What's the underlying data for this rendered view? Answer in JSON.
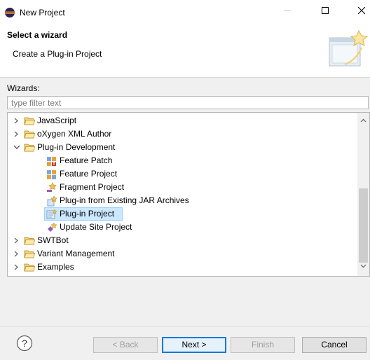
{
  "window": {
    "title": "New Project",
    "controls": [
      "minimize-icon",
      "maximize-icon",
      "close-icon"
    ]
  },
  "banner": {
    "title": "Select a wizard",
    "description": "Create a Plug-in Project"
  },
  "wizards": {
    "label": "Wizards:",
    "filter_placeholder": "type filter text"
  },
  "tree": {
    "items": [
      {
        "label": "JavaScript",
        "level": 0,
        "expanded": false,
        "icon": "folder-icon"
      },
      {
        "label": "oXygen XML Author",
        "level": 0,
        "expanded": false,
        "icon": "folder-icon"
      },
      {
        "label": "Plug-in Development",
        "level": 0,
        "expanded": true,
        "icon": "folder-icon"
      },
      {
        "label": "Feature Patch",
        "level": 1,
        "icon": "feature-patch-icon"
      },
      {
        "label": "Feature Project",
        "level": 1,
        "icon": "feature-project-icon"
      },
      {
        "label": "Fragment Project",
        "level": 1,
        "icon": "fragment-project-icon"
      },
      {
        "label": "Plug-in from Existing JAR Archives",
        "level": 1,
        "icon": "plugin-from-jar-icon"
      },
      {
        "label": "Plug-in Project",
        "level": 1,
        "icon": "plugin-project-icon",
        "selected": true
      },
      {
        "label": "Update Site Project",
        "level": 1,
        "icon": "update-site-project-icon"
      },
      {
        "label": "SWTBot",
        "level": 0,
        "expanded": false,
        "icon": "folder-icon"
      },
      {
        "label": "Variant Management",
        "level": 0,
        "expanded": false,
        "icon": "folder-icon"
      },
      {
        "label": "Examples",
        "level": 0,
        "expanded": false,
        "icon": "folder-icon"
      }
    ]
  },
  "buttons": {
    "help_icon": "help-icon",
    "back": "< Back",
    "next": "Next >",
    "finish": "Finish",
    "cancel": "Cancel"
  },
  "colors": {
    "selection": "#cce8ff",
    "default_button_border": "#0078d7",
    "folder": "#e8b84a"
  }
}
